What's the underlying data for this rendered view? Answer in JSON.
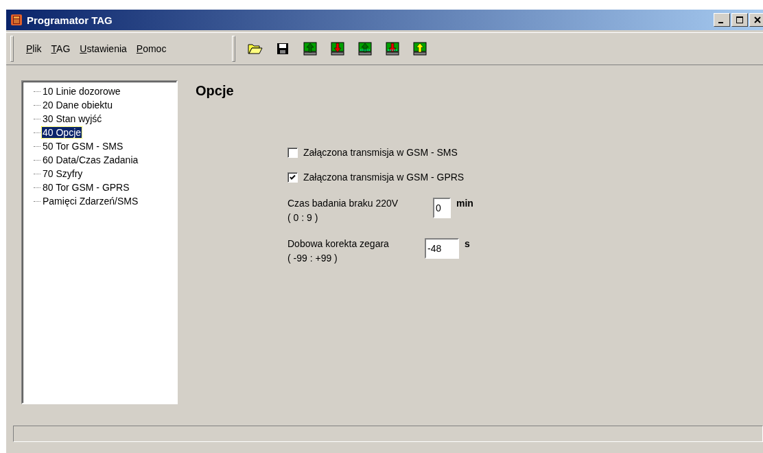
{
  "window": {
    "title": "Programator TAG"
  },
  "menu": [
    {
      "label": "Plik"
    },
    {
      "label": "TAG"
    },
    {
      "label": "Ustawienia"
    },
    {
      "label": "Pomoc"
    }
  ],
  "tree": [
    {
      "label": "10 Linie dozorowe",
      "selected": false
    },
    {
      "label": "20 Dane obiektu",
      "selected": false
    },
    {
      "label": "30 Stan wyjść",
      "selected": false
    },
    {
      "label": "40 Opcje",
      "selected": true
    },
    {
      "label": "50 Tor GSM - SMS",
      "selected": false
    },
    {
      "label": "60 Data/Czas Zadania",
      "selected": false
    },
    {
      "label": "70 Szyfry",
      "selected": false
    },
    {
      "label": "80 Tor GSM - GPRS",
      "selected": false
    },
    {
      "label": "Pamięci Zdarzeń/SMS",
      "selected": false
    }
  ],
  "panel": {
    "heading": "Opcje",
    "fields": [
      {
        "kind": "checkbox",
        "label": "Załączona transmisja w GSM - SMS",
        "checked": false
      },
      {
        "kind": "checkbox",
        "label": "Załączona transmisja w GSM - GPRS",
        "checked": true
      },
      {
        "kind": "number",
        "label": "Czas badania braku 220V",
        "range": "( 0 : 9 )",
        "entry": "0",
        "unit": "min"
      },
      {
        "kind": "number",
        "label": "Dobowa korekta zegara",
        "range": "( -99  : +99 )",
        "entry": "-48",
        "unit": "s"
      }
    ]
  }
}
